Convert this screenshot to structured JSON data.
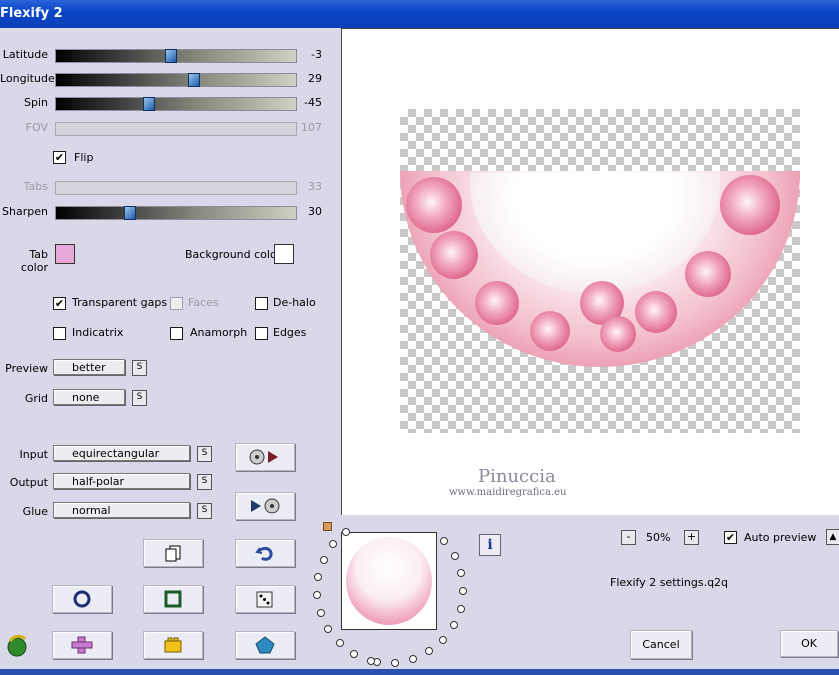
{
  "window": {
    "title": "Flexify 2"
  },
  "sliders": [
    {
      "label": "Latitude",
      "value": "-3",
      "fraction": 0.48,
      "enabled": true
    },
    {
      "label": "Longitude",
      "value": "29",
      "fraction": 0.58,
      "enabled": true
    },
    {
      "label": "Spin",
      "value": "-45",
      "fraction": 0.38,
      "enabled": true
    },
    {
      "label": "FOV",
      "value": "107",
      "fraction": 0.0,
      "enabled": false
    },
    {
      "label": "Tabs",
      "value": "33",
      "fraction": 0.0,
      "enabled": false
    },
    {
      "label": "Sharpen",
      "value": "30",
      "fraction": 0.3,
      "enabled": true
    }
  ],
  "flip": {
    "label": "Flip",
    "checked": true
  },
  "colors": {
    "tab_label": "Tab color",
    "tab_value": "#e6a8d6",
    "background_label": "Background color",
    "background_value": "#ffffff"
  },
  "options": {
    "transparent_gaps": {
      "label": "Transparent gaps",
      "checked": true
    },
    "faces": {
      "label": "Faces",
      "checked": false,
      "enabled": false
    },
    "de_halo": {
      "label": "De-halo",
      "checked": false
    },
    "indicatrix": {
      "label": "Indicatrix",
      "checked": false
    },
    "anamorph": {
      "label": "Anamorph",
      "checked": false
    },
    "edges": {
      "label": "Edges",
      "checked": false
    }
  },
  "preview_select": {
    "label": "Preview",
    "value": "better"
  },
  "grid_select": {
    "label": "Grid",
    "value": "none"
  },
  "input_select": {
    "label": "Input",
    "value": "equirectangular"
  },
  "output_select": {
    "label": "Output",
    "value": "half-polar"
  },
  "glue_select": {
    "label": "Glue",
    "value": "normal"
  },
  "s_label": "S",
  "watermark": {
    "name": "Pinuccia",
    "url": "www.maidiregrafica.eu"
  },
  "zoom": {
    "minus": "-",
    "value": "50%",
    "plus": "+"
  },
  "auto_preview": {
    "label": "Auto preview",
    "checked": true
  },
  "settings_file": "Flexify 2 settings.q2q",
  "info_label": "i",
  "buttons": {
    "cancel": "Cancel",
    "ok": "OK"
  },
  "icons": [
    "copy-icon",
    "undo-icon",
    "circle-icon",
    "square-icon",
    "dice-icon",
    "cross-icon",
    "lego-icon",
    "pentagon-icon",
    "logo-icon",
    "play-disc-icon",
    "disc-play-icon"
  ]
}
